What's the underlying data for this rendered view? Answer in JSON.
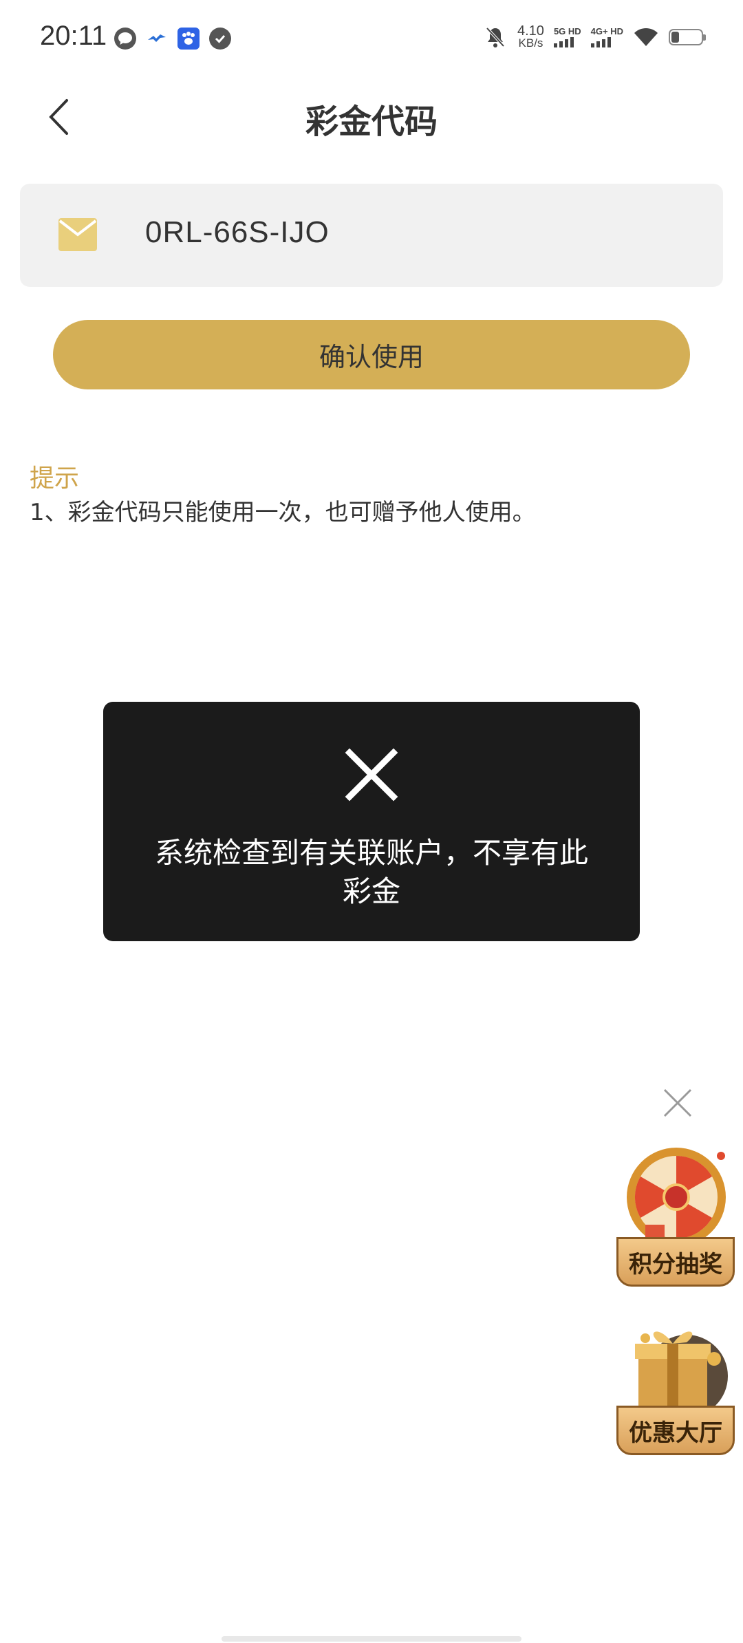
{
  "status_bar": {
    "time": "20:11",
    "net_speed_value": "4.10",
    "net_speed_unit": "KB/s",
    "sim1_label": "5G HD",
    "sim2_label": "4G+ HD",
    "notification_icons": [
      "message-icon",
      "bird-icon",
      "paw-icon",
      "check-icon"
    ],
    "battery_level": 0.25
  },
  "header": {
    "title": "彩金代码"
  },
  "code_field": {
    "value": "0RL-66S-IJO",
    "icon": "mail-icon"
  },
  "confirm_button": {
    "label": "确认使用"
  },
  "tips": {
    "heading": "提示",
    "lines": [
      "1、彩金代码只能使用一次，也可赠予他人使用。"
    ]
  },
  "toast": {
    "icon": "close-icon",
    "message": "系统检查到有关联账户，不享有此彩金"
  },
  "promos": [
    {
      "label": "积分抽奖",
      "icon": "prize-wheel-icon"
    },
    {
      "label": "优惠大厅",
      "icon": "gift-box-icon"
    }
  ],
  "colors": {
    "accent": "#d4af56",
    "tips_heading": "#cfa44b",
    "toast_bg": "#1b1b1b"
  }
}
